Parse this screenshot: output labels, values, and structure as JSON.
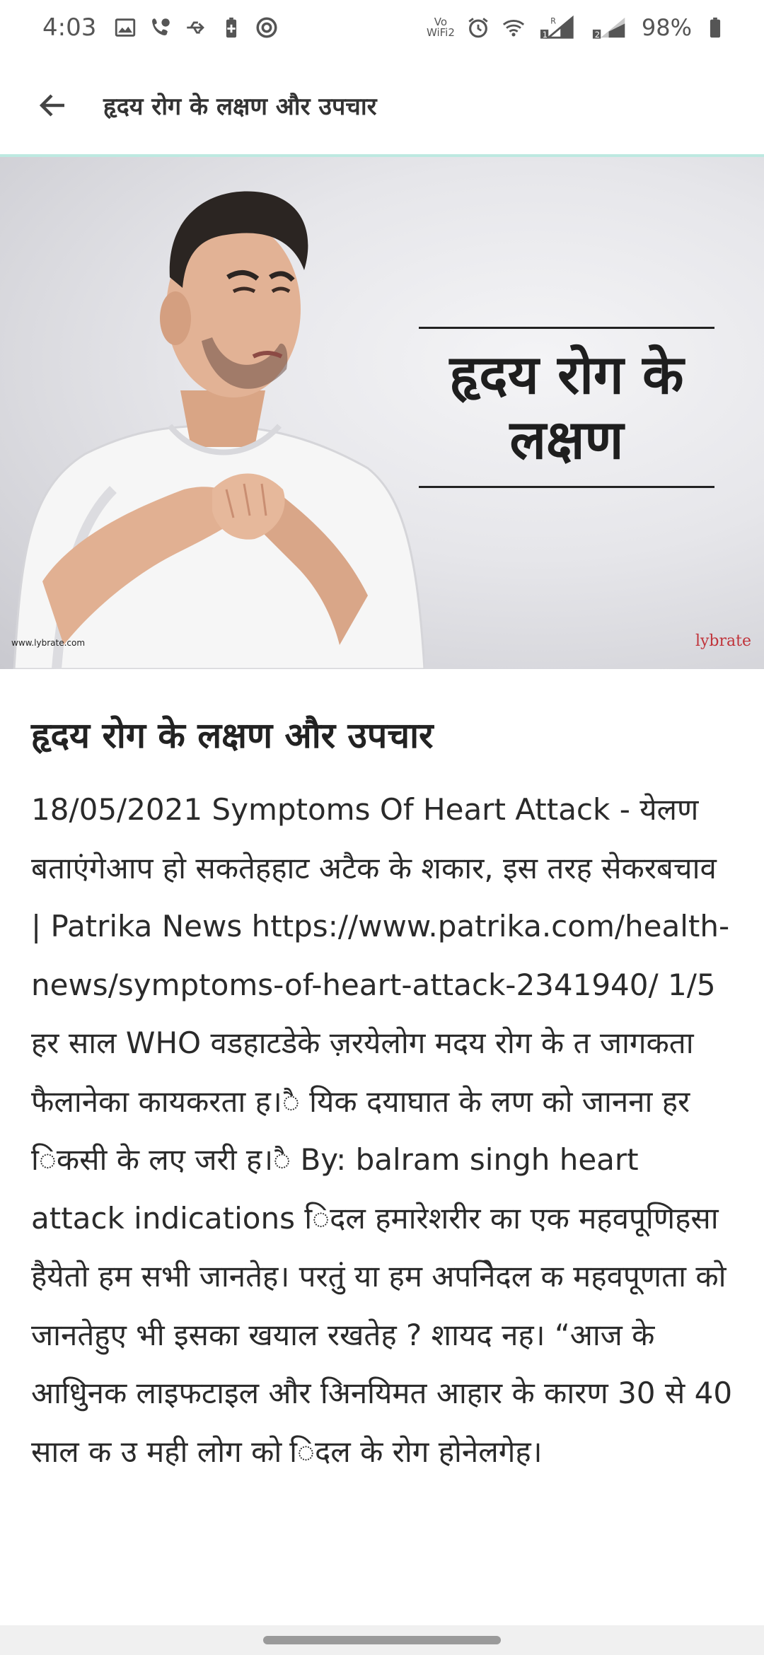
{
  "status_bar": {
    "time": "4:03",
    "vowifi_top": "Vo",
    "vowifi_bottom": "WiFi2",
    "battery_percent": "98%",
    "icons_left": [
      "image-icon",
      "phone-chat-icon",
      "usb-icon",
      "battery-saver-icon",
      "data-saver-icon"
    ],
    "icons_right": [
      "vowifi-icon",
      "alarm-icon",
      "wifi-icon",
      "signal-sim1-icon",
      "signal-sim2-icon",
      "battery-icon"
    ]
  },
  "app_bar": {
    "back_icon": "arrow-left-icon",
    "title": "हृदय रोग के लक्षण और उपचार"
  },
  "hero": {
    "overlay_text": "हृदय रोग के\nलक्षण",
    "site_watermark": "www.lybrate.com",
    "brand": "lybrate"
  },
  "article": {
    "title": "हृदय रोग के लक्षण और उपचार",
    "body": "18/05/2021 Symptoms Of Heart Attack - येलण बताएंगेआप हो सकतेहहाट अटैक के शकार, इस तरह सेकरबचाव | Patrika News https://www.patrika.com/health-news/symptoms-of-heart-attack-2341940/ 1/5 हर साल WHO वडहाटडेके ज़रयेलोग मदय रोग के त जागकता फैलानेका कायकरता ह।ै यिक दयाघात के लण को जानना हर िकसी के लए जरी ह।ै By: balram singh heart attack indications िदल हमारेशरीर का एक महवपूणिहसा हैयेतो हम सभी जानतेह। परतुं या हम अपनिेदल क महवपूणता को जानतेहुए भी इसका खयाल रखतेह ? शायद नह। “आज के आधुिनक लाइफटाइल और अिनयिमत आहार के कारण 30 से 40 साल क उ मही लोग को िदल के रोग होनेलगेह।"
  },
  "colors": {
    "divider": "#bde9e1",
    "brand_red": "#c0333a"
  }
}
